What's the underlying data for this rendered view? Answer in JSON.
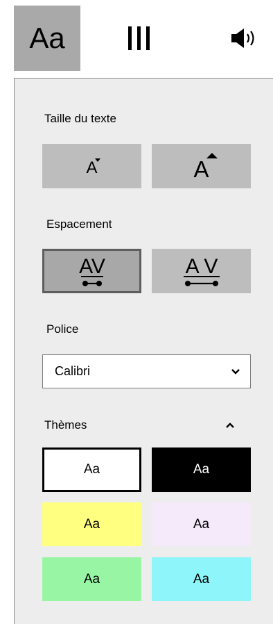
{
  "toolbar": {
    "text_button_label": "Aa",
    "text_button_icon": "text-options",
    "lines_icon": "reading-lines-icon",
    "audio_icon": "speaker-icon"
  },
  "panel": {
    "text_size": {
      "label": "Taille du texte",
      "decrease_glyph": "A",
      "increase_glyph": "A"
    },
    "spacing": {
      "label": "Espacement",
      "narrow_glyph": "AV",
      "wide_glyph": "A V",
      "selected": "narrow"
    },
    "font": {
      "label": "Police",
      "selected_value": "Calibri"
    },
    "themes": {
      "label": "Thèmes",
      "items": [
        {
          "label": "Aa",
          "bg": "#ffffff",
          "fg": "#000000",
          "selected": true
        },
        {
          "label": "Aa",
          "bg": "#000000",
          "fg": "#ffffff",
          "selected": false
        },
        {
          "label": "Aa",
          "bg": "#ffff80",
          "fg": "#000000",
          "selected": false
        },
        {
          "label": "Aa",
          "bg": "#f5eafa",
          "fg": "#000000",
          "selected": false
        },
        {
          "label": "Aa",
          "bg": "#98f5a4",
          "fg": "#000000",
          "selected": false
        },
        {
          "label": "Aa",
          "bg": "#8ef5fa",
          "fg": "#000000",
          "selected": false
        }
      ]
    }
  },
  "colors": {
    "panel_bg": "#ededed",
    "button_gray": "#bdbdbd",
    "active_tab": "#a9a9a9"
  }
}
